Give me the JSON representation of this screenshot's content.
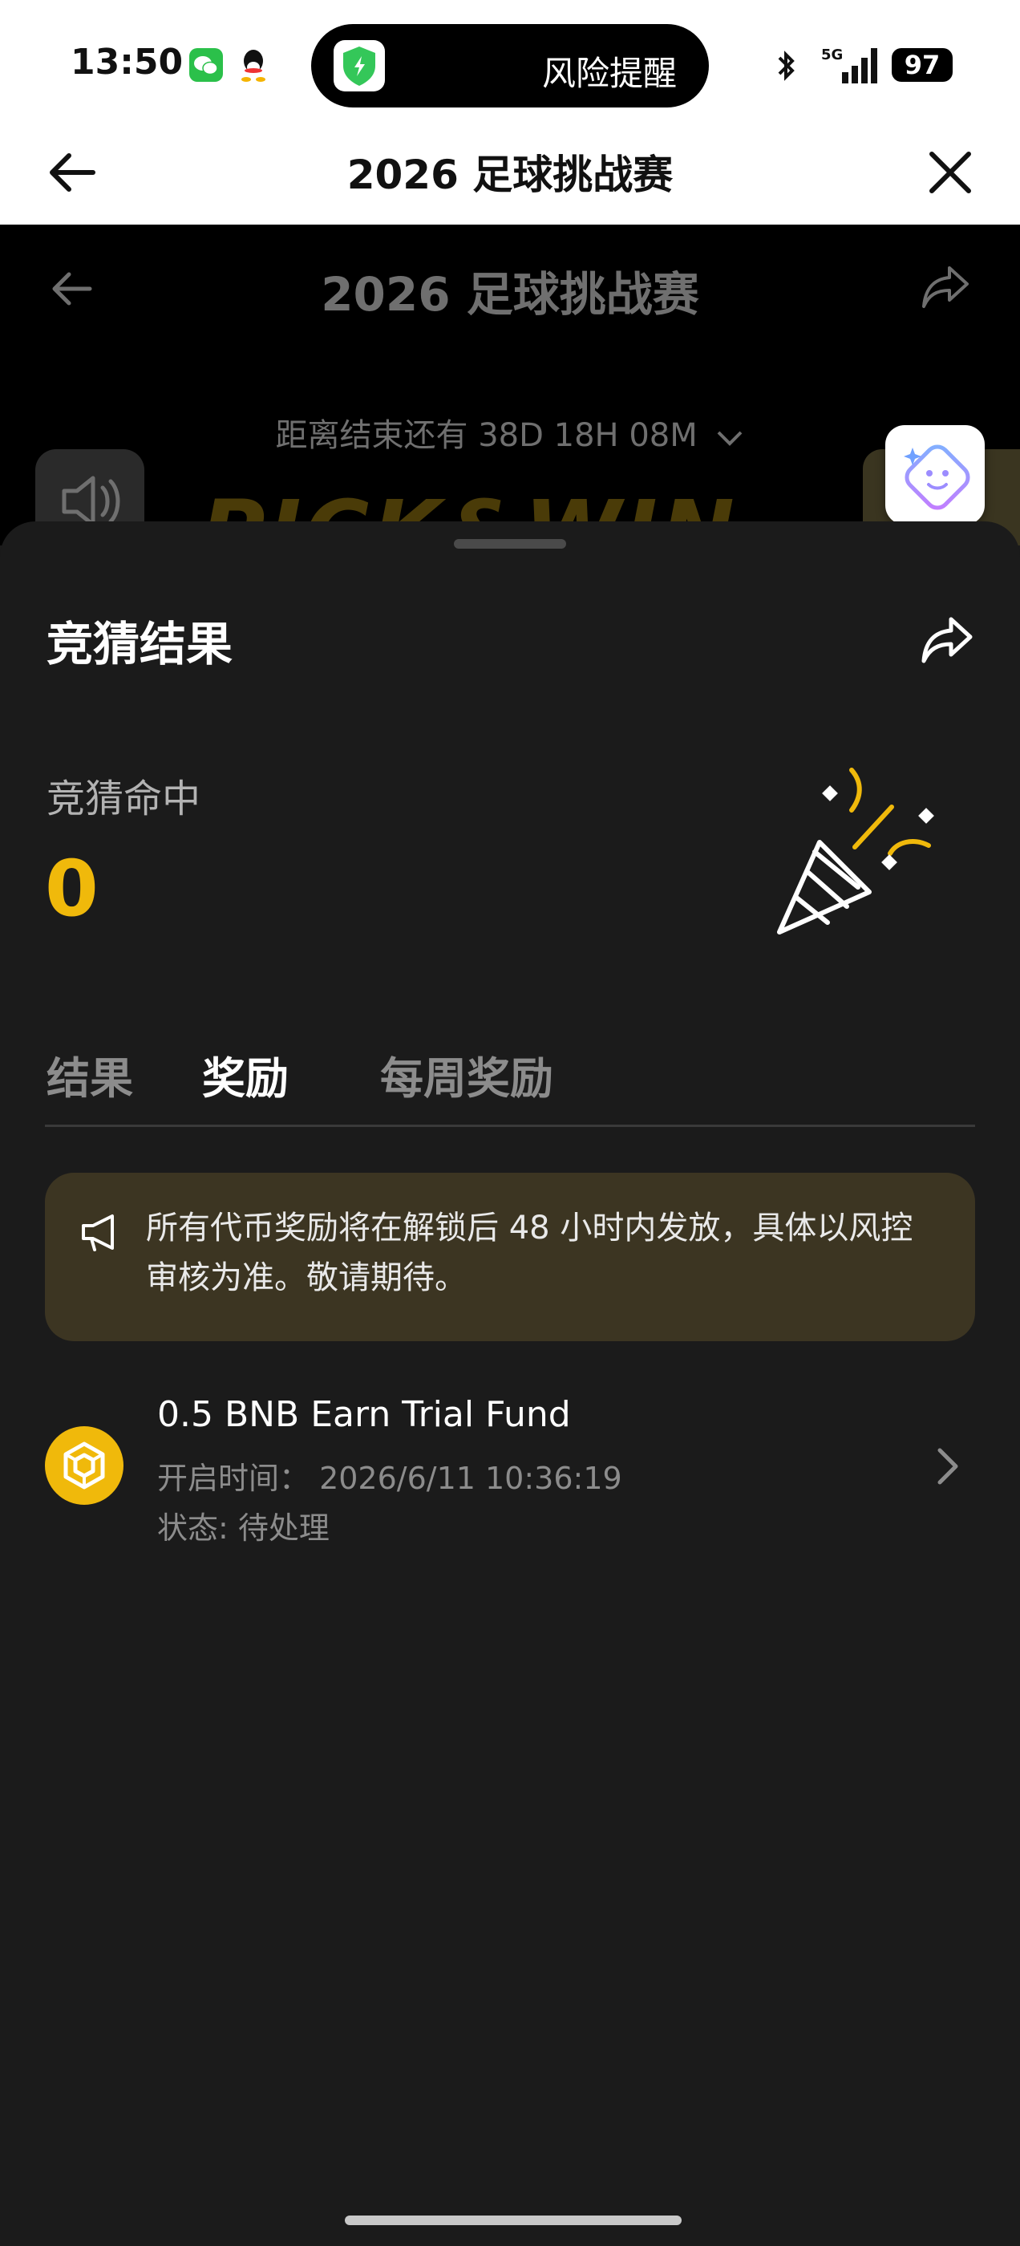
{
  "status_bar": {
    "time": "13:50",
    "pill_text": "风险提醒",
    "network": "5G",
    "battery": "97"
  },
  "navbar": {
    "title": "2026 足球挑战赛"
  },
  "background_page": {
    "title": "2026 足球挑战赛",
    "countdown": "距离结束还有 38D 18H 08M",
    "banner_text": "PICK&WIN"
  },
  "sheet": {
    "title": "竞猜结果",
    "hit_label": "竞猜命中",
    "hit_value": "0",
    "tabs": [
      {
        "label": "结果"
      },
      {
        "label": "奖励"
      },
      {
        "label": "每周奖励"
      }
    ],
    "notice": "所有代币奖励将在解锁后 48 小时内发放，具体以风控审核为准。敬请期待。",
    "reward": {
      "title": "0.5 BNB Earn Trial Fund",
      "open_time": "开启时间：  2026/6/11 10:36:19",
      "status": "状态: 待处理"
    }
  },
  "colors": {
    "accent": "#f0b90b",
    "sheet_bg": "#1b1b1b",
    "notice_bg": "#3c3522"
  }
}
